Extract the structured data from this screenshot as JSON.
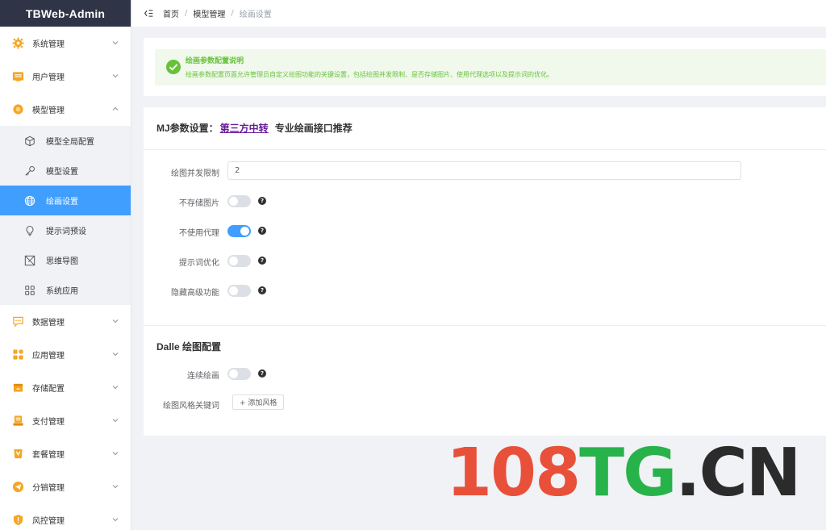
{
  "brand": {
    "title": "TBWeb-Admin"
  },
  "sidebar": {
    "items": [
      {
        "label": "系统管理",
        "icon": "gear-icon",
        "color": "#f5a623"
      },
      {
        "label": "用户管理",
        "icon": "id-card-icon",
        "color": "#f5a623"
      },
      {
        "label": "模型管理",
        "icon": "model-circle-icon",
        "color": "#f5a623",
        "expanded": true
      }
    ],
    "subitems": [
      {
        "label": "模型全局配置",
        "icon": "cube-icon"
      },
      {
        "label": "模型设置",
        "icon": "key-icon"
      },
      {
        "label": "绘画设置",
        "icon": "globe-icon",
        "active": true
      },
      {
        "label": "提示词预设",
        "icon": "lightbulb-icon"
      },
      {
        "label": "思维导图",
        "icon": "mindmap-icon"
      },
      {
        "label": "系统应用",
        "icon": "apps-grid-icon"
      }
    ],
    "items_after": [
      {
        "label": "数据管理",
        "icon": "chat-data-icon",
        "color": "#f5a623"
      },
      {
        "label": "应用管理",
        "icon": "app-blocks-icon",
        "color": "#f5a623"
      },
      {
        "label": "存储配置",
        "icon": "storage-icon",
        "color": "#f5a623"
      },
      {
        "label": "支付管理",
        "icon": "payment-icon",
        "color": "#f5a623"
      },
      {
        "label": "套餐管理",
        "icon": "package-icon",
        "color": "#f5a623"
      },
      {
        "label": "分销管理",
        "icon": "send-icon",
        "color": "#f5a623"
      },
      {
        "label": "风控管理",
        "icon": "shield-icon",
        "color": "#f5a623"
      }
    ]
  },
  "topbar": {
    "collapse_icon": "menu-fold-icon",
    "breadcrumb": [
      "首页",
      "模型管理",
      "绘画设置"
    ],
    "separator": "/"
  },
  "notice": {
    "title": "绘画参数配置说明",
    "desc": "绘画参数配置页面允许管理员自定义绘图功能的关键设置，包括绘图并发限制、是否存储图片、使用代理选项以及提示词的优化。",
    "color": "#67c23a"
  },
  "mj_section": {
    "title_prefix": "MJ参数设置：",
    "link_text": "第三方中转",
    "title_suffix": "专业绘画接口推荐",
    "fields": {
      "concurrency_label": "绘图并发限制",
      "concurrency_value": "2",
      "no_store_label": "不存储图片",
      "no_store_on": false,
      "no_proxy_label": "不使用代理",
      "no_proxy_on": true,
      "prompt_opt_label": "提示词优化",
      "prompt_opt_on": false,
      "hide_adv_label": "隐藏高级功能",
      "hide_adv_on": false
    },
    "help_glyph": "?"
  },
  "dalle_section": {
    "title": "Dalle 绘图配置",
    "continuous_label": "连续绘画",
    "continuous_on": false,
    "style_label": "绘图风格关键词",
    "add_style_button": "+ 添加风格"
  },
  "watermark": {
    "part1": "108",
    "part2": "TG",
    "part3": ".CN"
  },
  "colors": {
    "accent": "#409eff",
    "brand_bg": "#2f3447",
    "success": "#67c23a"
  }
}
